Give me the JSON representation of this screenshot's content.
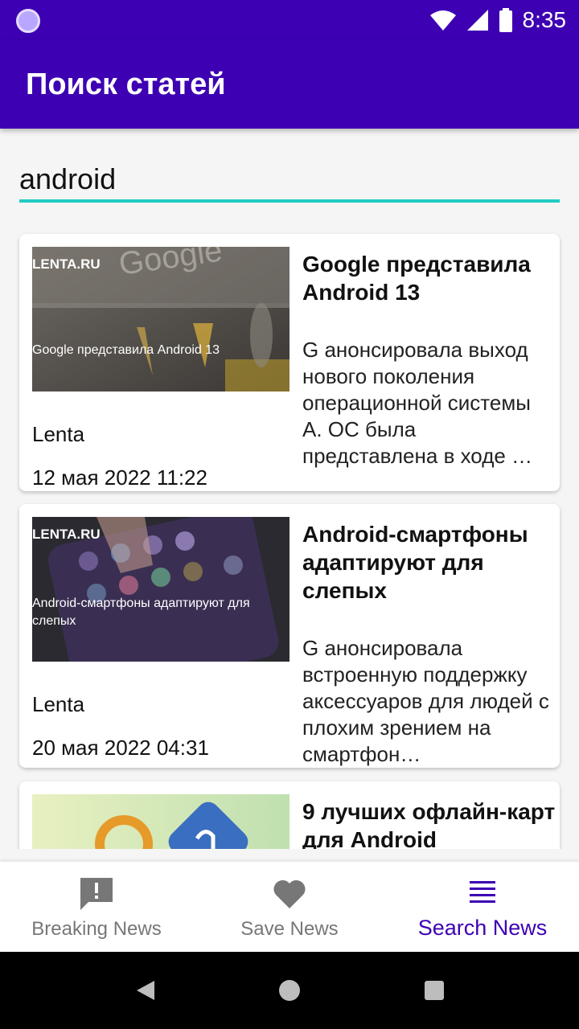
{
  "status_bar": {
    "time": "8:35"
  },
  "app_bar": {
    "title": "Поиск статей"
  },
  "search": {
    "value": "android"
  },
  "articles": [
    {
      "thumb_source": "LENTA.RU",
      "thumb_caption": "Google представила Android 13",
      "title": "Google представила Android 13",
      "description": "G анонсировала выход нового поколения операционной системы А. ОС была представлена в ходе …",
      "source": "Lenta",
      "date": "12 мая 2022 11:22"
    },
    {
      "thumb_source": "LENTA.RU",
      "thumb_caption": "Android-смартфоны адаптируют для слепых",
      "title": "Android-смартфоны адаптируют для слепых",
      "description": "G анонсировала встроенную поддержку аксессуаров для людей с плохим зрением на смартфон…",
      "source": "Lenta",
      "date": "20 мая 2022 04:31"
    },
    {
      "title": "9 лучших офлайн-карт для Android"
    }
  ],
  "bottom_nav": {
    "items": [
      {
        "label": "Breaking News",
        "icon": "alert-message-icon"
      },
      {
        "label": "Save News",
        "icon": "heart-icon"
      },
      {
        "label": "Search News",
        "icon": "menu-lines-icon"
      }
    ],
    "active_index": 2
  },
  "colors": {
    "primary": "#3d00b3",
    "accent": "#22ccc4",
    "inactive": "#777777"
  }
}
